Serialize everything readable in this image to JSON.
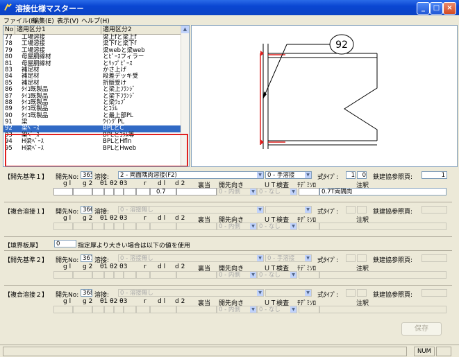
{
  "window": {
    "title": "溶接仕様マスター－"
  },
  "menu": [
    "ファイル(F)",
    "編集(E)",
    "表示(V)",
    "ヘルプ(H)"
  ],
  "list": {
    "columns": [
      "No",
      "適用区分1",
      "適用区分2"
    ],
    "rows": [
      {
        "no": "77",
        "c1": "工場溶接",
        "c2": "梁上fと梁上f"
      },
      {
        "no": "78",
        "c1": "工場溶接",
        "c2": "梁下fと梁下f"
      },
      {
        "no": "79",
        "c1": "工場溶接",
        "c2": "梁webと梁web"
      },
      {
        "no": "80",
        "c1": "母屋胴縁材",
        "c2": "とﾋﾟｰｽフィラー"
      },
      {
        "no": "81",
        "c1": "母屋胴縁材",
        "c2": "とﾘｯﾌﾟﾋﾟｰｽ"
      },
      {
        "no": "83",
        "c1": "補足材",
        "c2": "かさ上げ"
      },
      {
        "no": "84",
        "c1": "補足材",
        "c2": "段差デッキ受"
      },
      {
        "no": "85",
        "c1": "補足材",
        "c2": "折版受け"
      },
      {
        "no": "86",
        "c1": "ﾀｲｺ既製品",
        "c2": "と梁上ﾌﾗﾝｼﾞ"
      },
      {
        "no": "87",
        "c1": "ﾀｲｺ既製品",
        "c2": "と梁下ﾌﾗﾝｼﾞ"
      },
      {
        "no": "88",
        "c1": "ﾀｲｺ既製品",
        "c2": "と梁ｳｪﾌﾞ"
      },
      {
        "no": "89",
        "c1": "ﾀｲｺ既製品",
        "c2": "とｺﾗﾑ"
      },
      {
        "no": "90",
        "c1": "ﾀｲｺ既製品",
        "c2": "と最上部PL"
      },
      {
        "no": "91",
        "c1": "梁",
        "c2": "ｳｲﾝｸﾞPL"
      },
      {
        "no": "92",
        "c1": "梁ﾍﾞｰｽ",
        "c2": "BPLとC"
      },
      {
        "no": "93",
        "c1": "梁ﾍﾞｰｽ",
        "c2": "BPLとｺﾗﾑ等"
      },
      {
        "no": "94",
        "c1": "H梁ﾍﾞｰｽ",
        "c2": "BPLとHfln"
      },
      {
        "no": "95",
        "c1": "H梁ﾍﾞｰｽ",
        "c2": "BPLとHweb"
      }
    ],
    "selected_index": 14
  },
  "drawing": {
    "label": "92"
  },
  "groups": [
    {
      "title": "【開先基準１】",
      "no_label": "開先No:",
      "no": "365",
      "weld_label": "溶接:",
      "weld": "2 - 両面隅肉溶接(F2)",
      "hand": "0 - 手溶接",
      "shiki_label": "式ﾀｲﾌﾟ:",
      "shiki_a": "1",
      "shiki_b": "0",
      "ref_label": "鉄建協参照頁:",
      "ref": "1",
      "enabled": true,
      "hdr": [
        "g l",
        "g 2",
        "θ1 θ2 θ3",
        "r",
        "d l",
        "d 2",
        "裏当",
        "開先向き",
        "ＵＴ検査",
        "ﾁﾃﾞﾐｿﾛ",
        "注釈"
      ],
      "vals": {
        "d1": "0.7",
        "dir": "0 - 内側",
        "ut": "0 - なし",
        "note": "0.7T両隅肉"
      }
    },
    {
      "title": "【複合溶接１】",
      "no_label": "開先No:",
      "no": "366",
      "weld_label": "溶接:",
      "weld": "0 - 溶接無し",
      "hand": "",
      "shiki_label": "式ﾀｲﾌﾟ:",
      "shiki_a": "",
      "shiki_b": "",
      "ref_label": "鉄建協参照頁:",
      "ref": "",
      "enabled": false,
      "hdr": [
        "g l",
        "g 2",
        "θ1 θ2 θ3",
        "r",
        "d l",
        "d 2",
        "裏当",
        "開先向き",
        "ＵＴ検査",
        "ﾁﾃﾞﾐｿﾛ",
        "注釈"
      ],
      "vals": {
        "d1": "",
        "dir": "0 - 内側",
        "ut": "0 - なし",
        "note": ""
      }
    },
    {
      "title": "【開先基準２】",
      "no_label": "開先No:",
      "no": "367",
      "weld_label": "溶接:",
      "weld": "0 - 溶接無し",
      "hand": "0 - 手溶接",
      "shiki_label": "式ﾀｲﾌﾟ:",
      "shiki_a": "",
      "shiki_b": "",
      "ref_label": "鉄建協参照頁:",
      "ref": "",
      "enabled": false,
      "hdr": [
        "g l",
        "g 2",
        "θ1 θ2 θ3",
        "r",
        "d l",
        "d 2",
        "裏当",
        "開先向き",
        "ＵＴ検査",
        "ﾁﾃﾞﾐｿﾛ",
        "注釈"
      ],
      "vals": {
        "d1": "",
        "dir": "0 - 内側",
        "ut": "0 - なし",
        "note": ""
      }
    },
    {
      "title": "【複合溶接２】",
      "no_label": "開先No:",
      "no": "368",
      "weld_label": "溶接:",
      "weld": "0 - 溶接無し",
      "hand": "",
      "shiki_label": "式ﾀｲﾌﾟ:",
      "shiki_a": "",
      "shiki_b": "",
      "ref_label": "鉄建協参照頁:",
      "ref": "",
      "enabled": false,
      "hdr": [
        "g l",
        "g 2",
        "θ1 θ2 θ3",
        "r",
        "d l",
        "d 2",
        "裏当",
        "開先向き",
        "ＵＴ検査",
        "ﾁﾃﾞﾐｿﾛ",
        "注釈"
      ],
      "vals": {
        "d1": "",
        "dir": "0 - 内側",
        "ut": "0 - なし",
        "note": ""
      }
    }
  ],
  "boundary": {
    "title": "【境界板厚】",
    "value": "0",
    "text": "指定厚より大きい場合は以下の値を使用"
  },
  "buttons": {
    "save": "保存"
  },
  "statusbar": {
    "num": "NUM"
  },
  "colors": {
    "titlebar": "#0a46d2",
    "selection": "#316ac5",
    "highlight": "#e0201f",
    "drawing_red": "#e0201f"
  }
}
